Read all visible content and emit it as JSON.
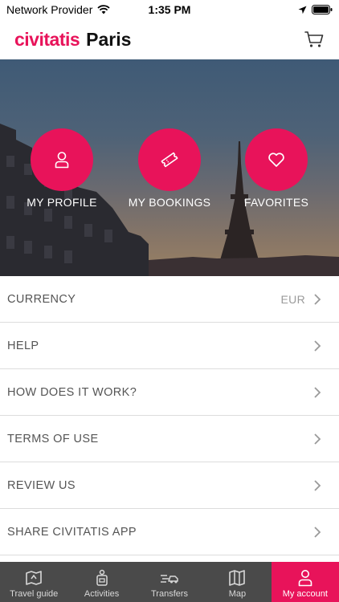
{
  "status_bar": {
    "carrier": "Network Provider",
    "time": "1:35 PM"
  },
  "header": {
    "brand": "civitatis",
    "city": "Paris",
    "cart_icon": "shopping-cart-icon"
  },
  "colors": {
    "accent": "#e8135a",
    "tabbar_bg": "#4a4a4a"
  },
  "hero": {
    "buttons": [
      {
        "label": "MY PROFILE",
        "icon": "user-icon"
      },
      {
        "label": "MY BOOKINGS",
        "icon": "ticket-icon"
      },
      {
        "label": "FAVORITES",
        "icon": "heart-icon"
      }
    ]
  },
  "menu": {
    "items": [
      {
        "label": "CURRENCY",
        "value": "EUR"
      },
      {
        "label": "HELP"
      },
      {
        "label": "HOW DOES IT WORK?"
      },
      {
        "label": "TERMS OF USE"
      },
      {
        "label": "REVIEW US"
      },
      {
        "label": "SHARE CIVITATIS APP"
      }
    ]
  },
  "tabbar": {
    "tabs": [
      {
        "label": "Travel guide",
        "icon": "travel-guide-icon"
      },
      {
        "label": "Activities",
        "icon": "activities-icon"
      },
      {
        "label": "Transfers",
        "icon": "transfers-icon"
      },
      {
        "label": "Map",
        "icon": "map-icon"
      },
      {
        "label": "My account",
        "icon": "account-icon",
        "active": true
      }
    ]
  }
}
